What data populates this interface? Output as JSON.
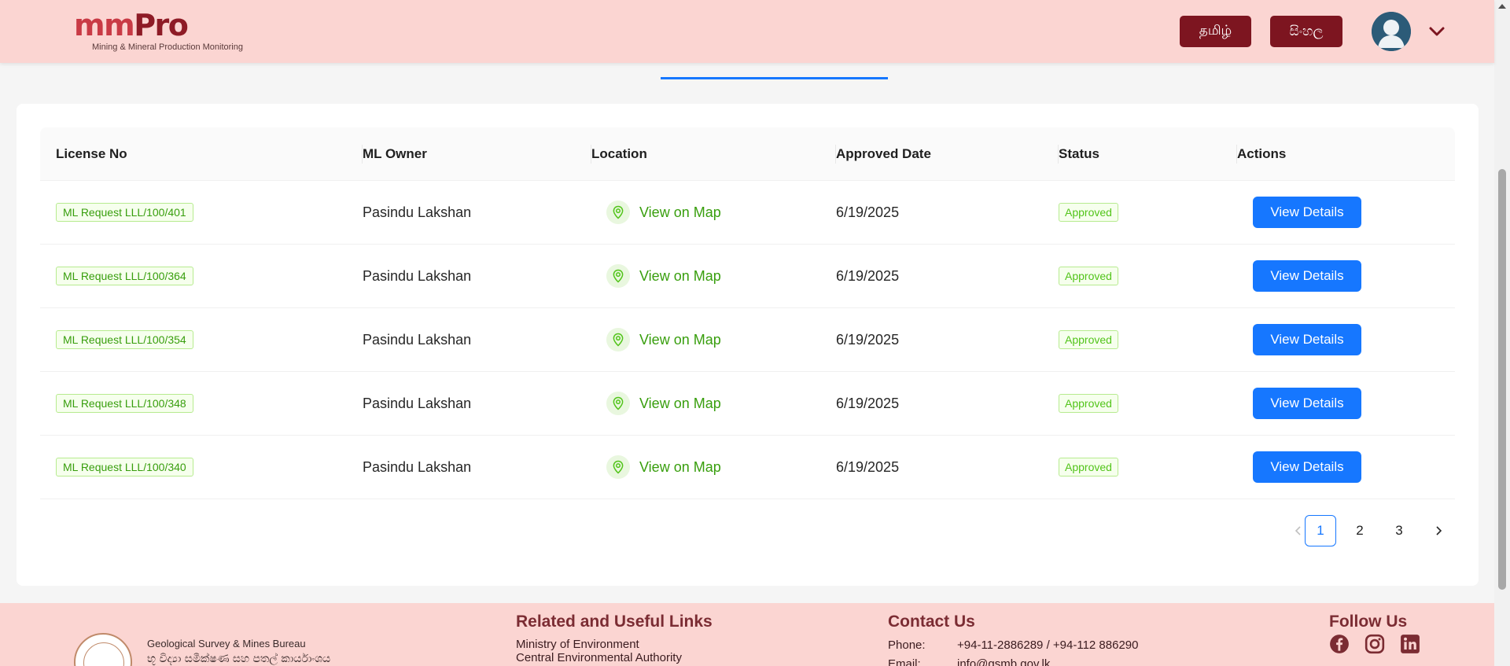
{
  "header": {
    "logo_mm": "mm",
    "logo_pro": "Pro",
    "logo_subtitle": "Mining & Mineral Production Monitoring",
    "lang_tamil": "தமிழ்",
    "lang_sinhala": "සිංහල"
  },
  "table": {
    "columns": [
      "License No",
      "ML Owner",
      "Location",
      "Approved Date",
      "Status",
      "Actions"
    ],
    "rows": [
      {
        "license": "ML Request LLL/100/401",
        "owner": "Pasindu Lakshan",
        "location": "View on Map",
        "date": "6/19/2025",
        "status": "Approved",
        "action": "View Details"
      },
      {
        "license": "ML Request LLL/100/364",
        "owner": "Pasindu Lakshan",
        "location": "View on Map",
        "date": "6/19/2025",
        "status": "Approved",
        "action": "View Details"
      },
      {
        "license": "ML Request LLL/100/354",
        "owner": "Pasindu Lakshan",
        "location": "View on Map",
        "date": "6/19/2025",
        "status": "Approved",
        "action": "View Details"
      },
      {
        "license": "ML Request LLL/100/348",
        "owner": "Pasindu Lakshan",
        "location": "View on Map",
        "date": "6/19/2025",
        "status": "Approved",
        "action": "View Details"
      },
      {
        "license": "ML Request LLL/100/340",
        "owner": "Pasindu Lakshan",
        "location": "View on Map",
        "date": "6/19/2025",
        "status": "Approved",
        "action": "View Details"
      }
    ]
  },
  "pagination": {
    "prev": "<",
    "pages": [
      "1",
      "2",
      "3"
    ],
    "current": "1",
    "next": ">"
  },
  "footer": {
    "org_name": "Geological Survey & Mines Bureau",
    "org_name_sinhala": "භූ විද්‍යා සමීක්ෂණ සහ පතල් කාර්යාංශය",
    "links_heading": "Related and Useful Links",
    "links": [
      "Ministry of Environment",
      "Central Environmental Authority"
    ],
    "contact_heading": "Contact Us",
    "phone_label": "Phone:",
    "phone_value": "+94-11-2886289 / +94-112 886290",
    "email_label": "Email:",
    "email_value": "info@gsmb.gov.lk",
    "follow_heading": "Follow Us"
  },
  "colors": {
    "brand_maroon": "#7d1520",
    "header_bg": "#fbd5d2",
    "primary_blue": "#1677ff",
    "success_green": "#52c41a"
  },
  "icons": [
    "user-avatar-icon",
    "chevron-down-icon",
    "map-pin-icon",
    "chevron-left-icon",
    "chevron-right-icon",
    "facebook-icon",
    "instagram-icon",
    "linkedin-icon"
  ]
}
